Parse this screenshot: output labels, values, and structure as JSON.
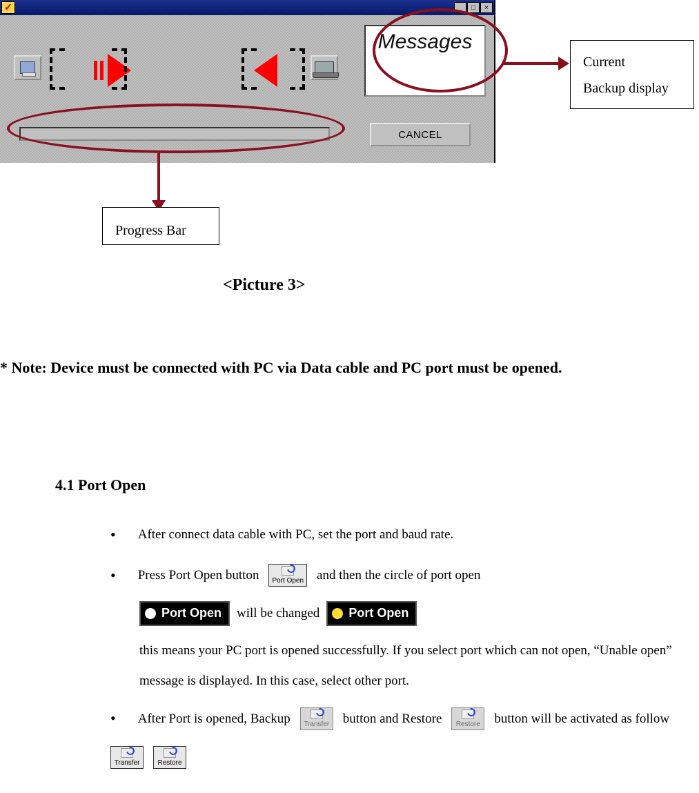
{
  "window": {
    "status_label": "Messages",
    "cancel_label": "CANCEL"
  },
  "callouts": {
    "current_backup_line1": "Current",
    "current_backup_line2": "Backup display",
    "progress_bar": "Progress Bar"
  },
  "caption": "<Picture 3>",
  "note": "* Note: Device must be connected with PC via Data cable and PC port must be opened.",
  "section": {
    "heading": "4.1 Port Open",
    "bullets": {
      "b1": "After connect data cable with PC, set the port and baud rate.",
      "b2a": "Press Port Open button",
      "b2b": "and then the circle of port open",
      "b2c": "will be changed",
      "b2d": "this means your PC port is opened successfully.   If you select port which can not open, “Unable open” message is displayed. In this case, select other port.",
      "b3a": "After Port is opened, Backup",
      "b3b": "button and Restore",
      "b3c": "button will be activated as follow"
    }
  },
  "inline_labels": {
    "port_open_small": "Port Open",
    "port_open_indicator": "Port Open",
    "transfer": "Transfer",
    "restore": "Restore"
  }
}
